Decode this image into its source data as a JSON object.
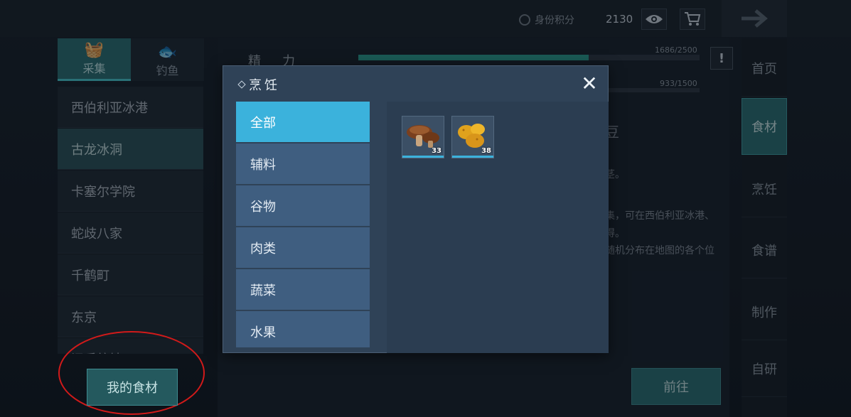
{
  "header": {
    "id_score_label": "身份积分",
    "score": "2130"
  },
  "left": {
    "tabs": [
      {
        "label": "采集"
      },
      {
        "label": "钓鱼"
      }
    ],
    "locations": [
      "西伯利亚冰港",
      "古龙冰洞",
      "卡塞尔学院",
      "蛇歧八家",
      "千鹤町",
      "东京",
      "旧系统地..."
    ],
    "active_location": "古龙冰洞",
    "my_ingredients_button": "我的食材"
  },
  "center": {
    "stat_label": "精力",
    "bar1_value": "1686/2500",
    "bar1_fraction": 0.6744,
    "bar2_value": "933/1500",
    "bean_title_fragment": "豆",
    "desc_line1": "茎。",
    "desc_line2": "集，可在西伯利亚冰港、",
    "desc_line3": "得。",
    "desc_line4": "随机分布在地图的各个位",
    "go_button": "前往"
  },
  "right_nav": {
    "items": [
      "首页",
      "食材",
      "烹饪",
      "食谱",
      "制作",
      "自研"
    ],
    "active": "食材"
  },
  "modal": {
    "title": "烹饪",
    "categories": [
      "全部",
      "辅料",
      "谷物",
      "肉类",
      "蔬菜",
      "水果"
    ],
    "active_category": "全部",
    "items": [
      {
        "icon": "mushroom-icon",
        "qty": "33"
      },
      {
        "icon": "potato-icon",
        "qty": "38"
      }
    ]
  },
  "colors": {
    "accent_teal": "#2b6e73",
    "accent_blue": "#3bb2dc",
    "annotation_red": "#d11a1a"
  }
}
